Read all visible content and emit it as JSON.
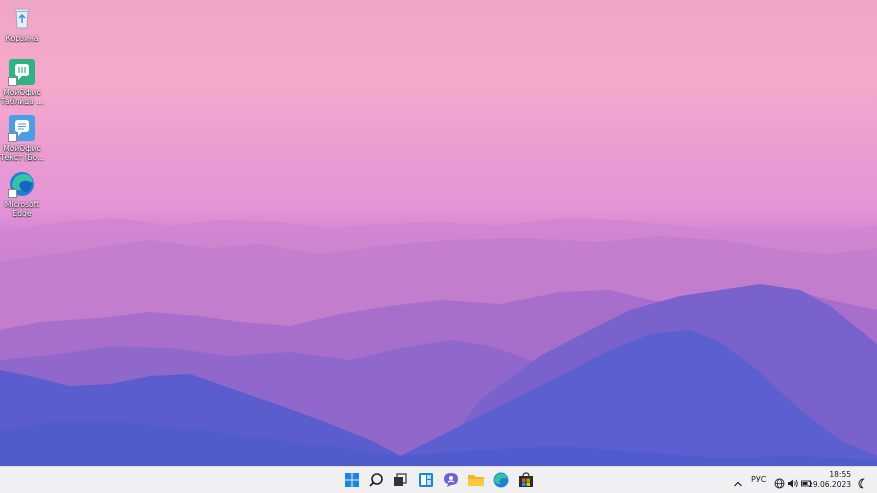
{
  "desktop": {
    "icons": [
      {
        "label_line1": "Корзина",
        "label_line2": "",
        "icon": "recycle-bin-icon"
      },
      {
        "label_line1": "МойОфис",
        "label_line2": "Таблица ...",
        "icon": "myoffice-spreadsheet-icon"
      },
      {
        "label_line1": "МойОфис",
        "label_line2": "Текст (Бо...",
        "icon": "myoffice-text-icon"
      },
      {
        "label_line1": "Microsoft",
        "label_line2": "Edge",
        "icon": "edge-icon"
      }
    ]
  },
  "taskbar": {
    "apps": [
      "start-icon",
      "search-icon",
      "task-view-icon",
      "widgets-icon",
      "chat-icon",
      "file-explorer-icon",
      "edge-icon",
      "store-icon"
    ],
    "tray": {
      "chevron": "chevron-up-icon",
      "language": "РУС",
      "icons": [
        "network-icon",
        "volume-icon",
        "battery-icon"
      ],
      "time": "18:55",
      "date": "19.06.2023",
      "notifications": "notification-icon"
    }
  },
  "colors": {
    "sky_top": "#f4a9cc",
    "sky_mid": "#e394d6",
    "mountain_far": "#c77fcf",
    "mountain_mid": "#9b6ccc",
    "mountain_near": "#6a5fcf",
    "taskbar_bg": "#f0f0f3"
  }
}
